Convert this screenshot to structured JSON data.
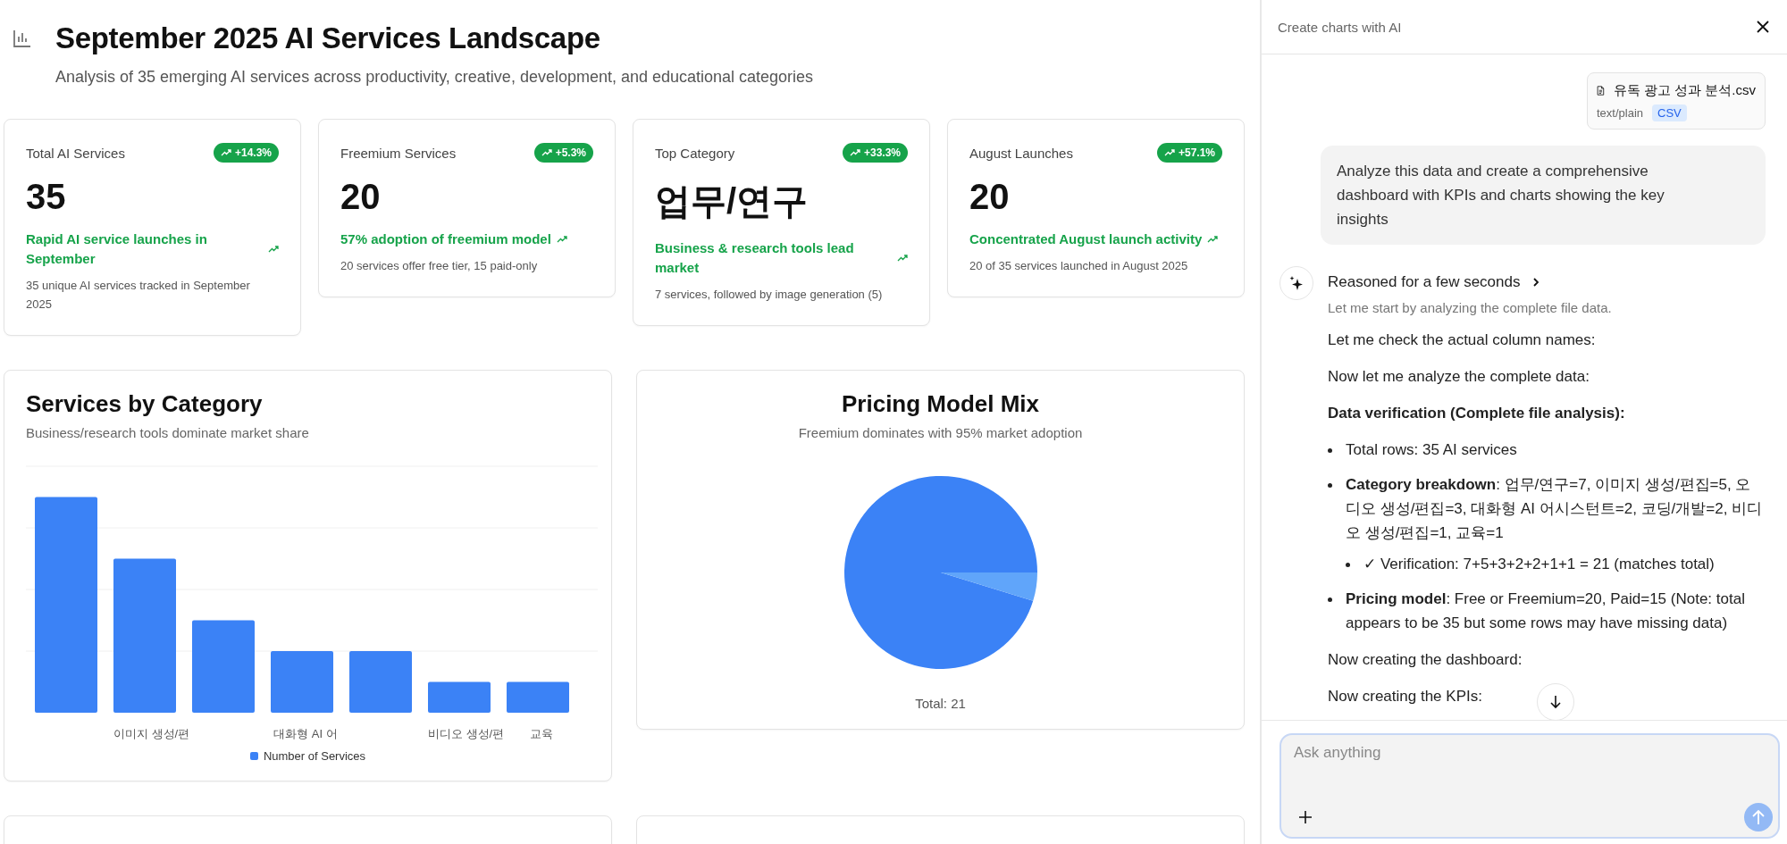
{
  "header": {
    "title": "September 2025 AI Services Landscape",
    "subtitle": "Analysis of 35 emerging AI services across productivity, creative, development, and educational categories"
  },
  "kpis": [
    {
      "label": "Total AI Services",
      "change": "+14.3%",
      "value": "35",
      "trend": "Rapid AI service launches in September",
      "note": "35 unique AI services tracked in September 2025"
    },
    {
      "label": "Freemium Services",
      "change": "+5.3%",
      "value": "20",
      "trend": "57% adoption of freemium model",
      "note": "20 services offer free tier, 15 paid-only"
    },
    {
      "label": "Top Category",
      "change": "+33.3%",
      "value": "업무/연구",
      "trend": "Business & research tools lead market",
      "note": "7 services, followed by image generation (5)"
    },
    {
      "label": "August Launches",
      "change": "+57.1%",
      "value": "20",
      "trend": "Concentrated August launch activity",
      "note": "20 of 35 services launched in August 2025"
    }
  ],
  "charts": [
    {
      "kind": "bar",
      "title": "Services by Category",
      "subtitle": "Business/research tools dominate market share",
      "x_labels": [
        "이미지 생성/편",
        "대화형 AI 어",
        "비디오 생성/편",
        "교육"
      ],
      "legend": "Number of Services"
    },
    {
      "kind": "pie",
      "title": "Pricing Model Mix",
      "subtitle": "Freemium dominates with 95% market adoption",
      "total": "Total: 21"
    }
  ],
  "chat": {
    "title": "Create charts with AI",
    "attachment": {
      "name": "유독 광고 성과 분석.csv",
      "type": "text/plain",
      "badge": "CSV"
    },
    "user_message": "Analyze this data and create a comprehensive dashboard with KPIs and charts showing the key insights",
    "reasoning": {
      "label": "Reasoned for a few seconds",
      "expanded": false,
      "summary": "Let me start by analyzing the complete file data."
    },
    "blocks": [
      {
        "kind": "paragraph",
        "text": "Let me check the actual column names:"
      },
      {
        "kind": "paragraph",
        "text": "Now let me analyze the complete data:"
      },
      {
        "kind": "heading",
        "text": "Data verification (Complete file analysis):"
      },
      {
        "kind": "list",
        "items": [
          {
            "text": "Total rows: 35 AI services"
          },
          {
            "text": "**Category breakdown**: 업무/연구=7, 이미지 생성/편집=5, 오디오 생성/편집=3, 대화형 AI 어시스턴트=2, 코딩/개발=2, 비디오 생성/편집=1, 교육=1",
            "children": [
              {
                "text": "✓ Verification: 7+5+3+2+2+1+1 = 21 (matches total)"
              }
            ]
          },
          {
            "text": "**Pricing model**: Free or Freemium=20, Paid=15 (Note: total appears to be 35 but some rows may have missing data)"
          }
        ]
      },
      {
        "kind": "paragraph",
        "text": "Now creating the dashboard:"
      },
      {
        "kind": "paragraph",
        "text": "Now creating the KPIs:"
      }
    ],
    "composer": {
      "placeholder": "Ask anything"
    }
  }
}
